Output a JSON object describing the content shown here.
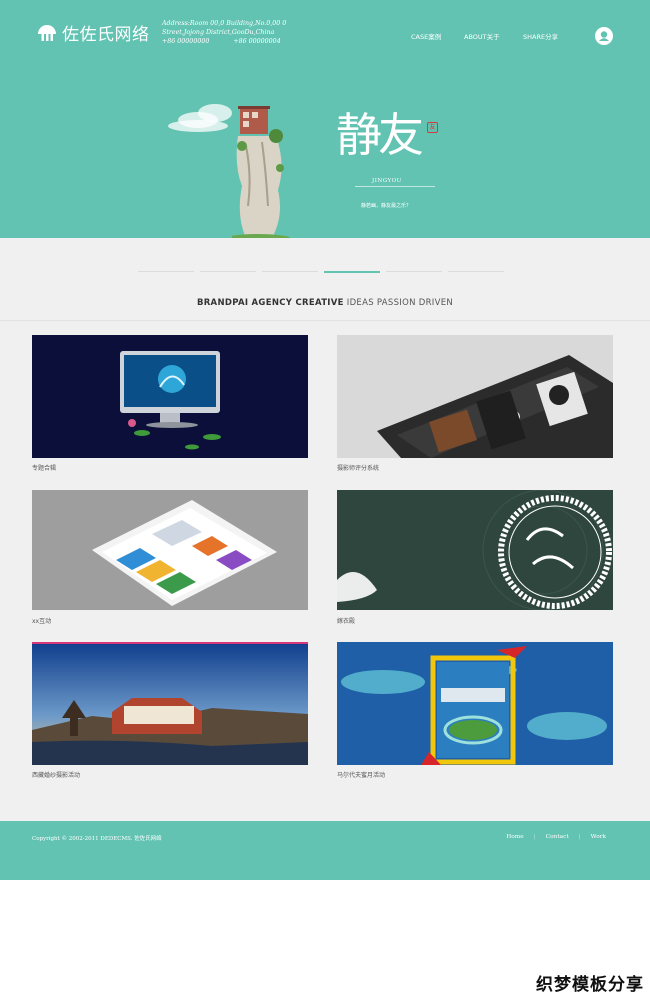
{
  "header": {
    "brand": "佐佐氏网络",
    "address": "Address:Room 00,0 Building,No.0,00 0 Street,Jojong District,GooDu,China",
    "phones": [
      "+86 00000000",
      "+86 00000004"
    ],
    "nav": [
      {
        "label": "CASE案例"
      },
      {
        "label": "ABOUT关于"
      },
      {
        "label": "SHARE分享"
      }
    ]
  },
  "hero": {
    "calligraphy": "静友",
    "seal": "友",
    "subtitle": "JINGYOU",
    "tagline": "静若幽，静友最之乐？"
  },
  "slider": {
    "count": 6,
    "active_index": 3
  },
  "slogan": {
    "bold": "BRANDPAI AGENCY CREATIVE",
    "rest": "IDEAS PASSION DRIVEN"
  },
  "portfolio": [
    {
      "caption": "专题合辑",
      "image": "imac-lotus"
    },
    {
      "caption": "摄影师评分系统",
      "image": "tablet-portraits"
    },
    {
      "caption": "xx互动",
      "image": "app-tiles"
    },
    {
      "caption": "嫁衣殿",
      "image": "wedding-lace"
    },
    {
      "caption": "西藏婚纱摄影活动",
      "image": "tibet-palace"
    },
    {
      "caption": "马尔代夫蜜月活动",
      "image": "maldives-island"
    }
  ],
  "footer": {
    "copyright": "Copyright © 2002-2011 DEDECMS. 佐佐氏网络",
    "links": [
      {
        "label": "Home"
      },
      {
        "label": "Contact"
      },
      {
        "label": "Work"
      }
    ]
  },
  "watermark": "织梦模板分享",
  "colors": {
    "brand": "#62c3b2",
    "background": "#f0f0f0"
  }
}
